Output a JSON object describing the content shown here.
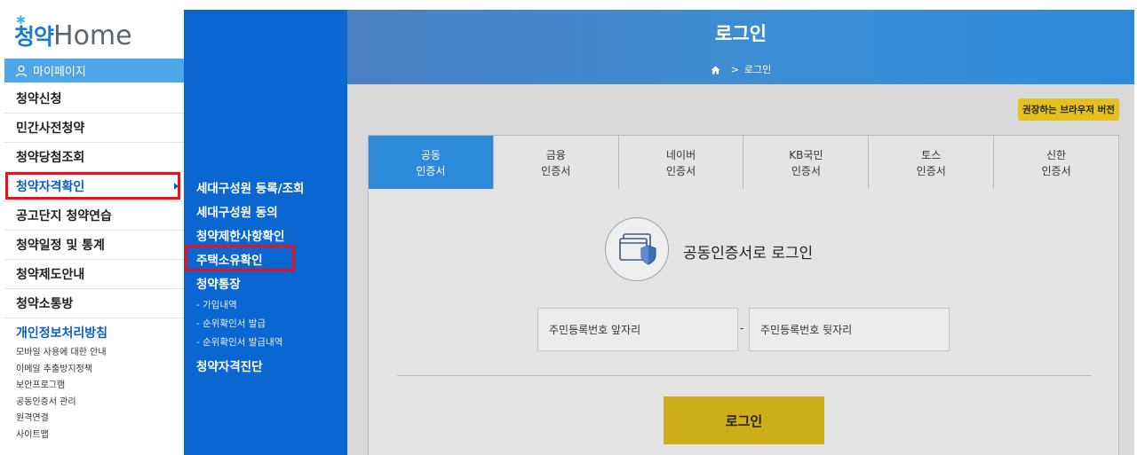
{
  "logo": {
    "korean": "청약",
    "english": "Home"
  },
  "sidebar": {
    "mypage_label": "마이페이지",
    "items": [
      {
        "label": "청약신청"
      },
      {
        "label": "민간사전청약"
      },
      {
        "label": "청약당첨조회"
      },
      {
        "label": "청약자격확인"
      },
      {
        "label": "공고단지 청약연습"
      },
      {
        "label": "청약일정 및 통계"
      },
      {
        "label": "청약제도안내"
      },
      {
        "label": "청약소통방"
      }
    ],
    "privacy_title": "개인정보처리방침",
    "links": [
      {
        "label": "모바일 사용에 대한 안내"
      },
      {
        "label": "이메일 추출방지정책"
      },
      {
        "label": "보안프로그램"
      },
      {
        "label": "공동인증서 관리"
      },
      {
        "label": "원격연결"
      },
      {
        "label": "사이트맵"
      }
    ]
  },
  "submenu": {
    "items": [
      {
        "label": "세대구성원 등록/조회"
      },
      {
        "label": "세대구성원 동의"
      },
      {
        "label": "청약제한사항확인"
      },
      {
        "label": "주택소유확인"
      },
      {
        "label": "청약통장"
      },
      {
        "label": "청약자격진단"
      }
    ],
    "sub_items": [
      {
        "label": "- 가입내역"
      },
      {
        "label": "- 순위확인서 발급"
      },
      {
        "label": "- 순위확인서 발급내역"
      }
    ]
  },
  "header": {
    "title": "로그인",
    "breadcrumb": "로그인"
  },
  "content": {
    "browser_button": "권장하는 브라우저 버전",
    "tabs": [
      {
        "line1": "공동",
        "line2": "인증서"
      },
      {
        "line1": "금융",
        "line2": "인증서"
      },
      {
        "line1": "네이버",
        "line2": "인증서"
      },
      {
        "line1": "KB국민",
        "line2": "인증서"
      },
      {
        "line1": "토스",
        "line2": "인증서"
      },
      {
        "line1": "신한",
        "line2": "인증서"
      }
    ],
    "cert_heading": "공동인증서로 로그인",
    "field_front_placeholder": "주민등록번호 앞자리",
    "field_back_placeholder": "주민등록번호 뒷자리",
    "separator": "-",
    "login_button": "로그인"
  },
  "colors": {
    "brand_blue": "#0a66d0",
    "header_blue": "#3b8fd6",
    "highlight_red": "#e8121c",
    "login_gold": "#cfae1b"
  }
}
